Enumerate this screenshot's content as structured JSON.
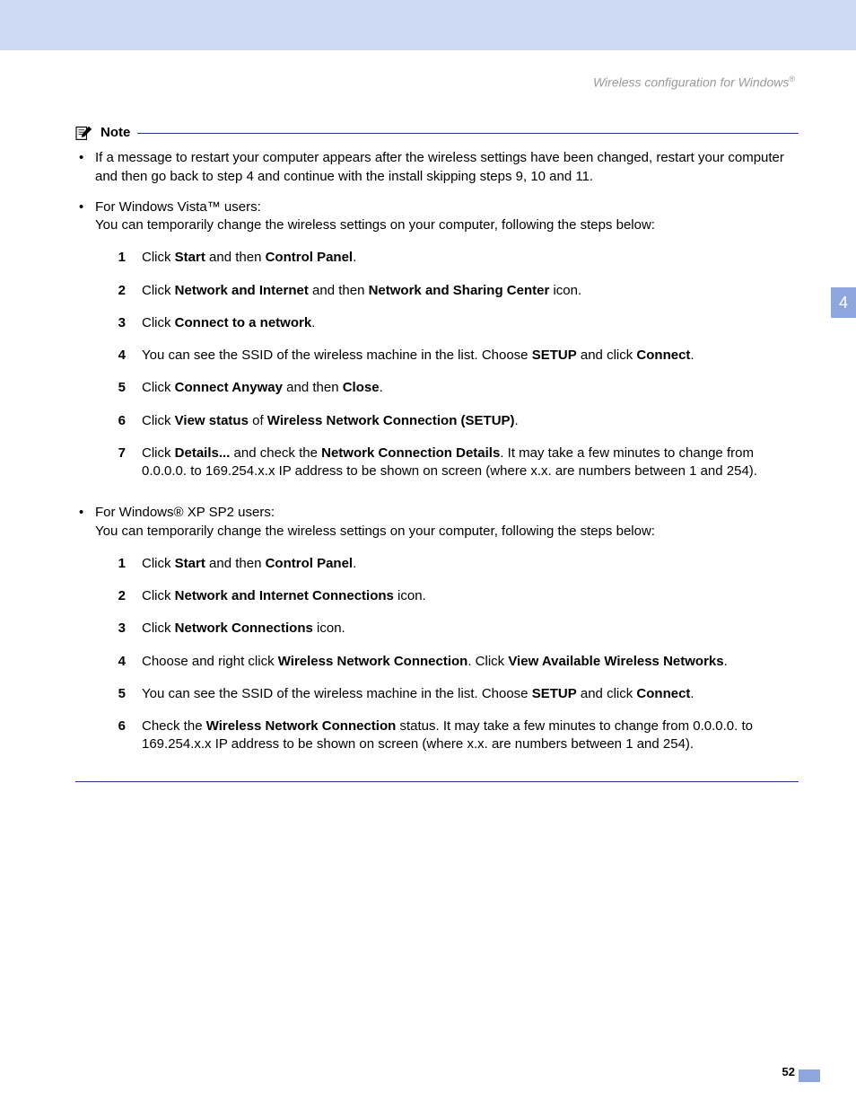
{
  "header": {
    "title": "Wireless configuration for Windows",
    "regmark": "®"
  },
  "sidetab": "4",
  "note": {
    "label": "Note"
  },
  "bullets": {
    "restart": {
      "text": "If a message to restart your computer appears after the wireless settings have been changed, restart your computer and then go back to step 4 and continue with the install skipping steps 9, 10 and 11."
    },
    "vista": {
      "intro1": "For Windows Vista™ users:",
      "intro2": "You can temporarily change the wireless settings on your computer, following the steps below:",
      "steps": {
        "s1": {
          "a": "Click ",
          "b": "Start",
          "c": " and then ",
          "d": "Control Panel",
          "e": "."
        },
        "s2": {
          "a": "Click ",
          "b": "Network and Internet",
          "c": " and then ",
          "d": "Network and Sharing Center",
          "e": " icon."
        },
        "s3": {
          "a": "Click ",
          "b": "Connect to a network",
          "c": "."
        },
        "s4": {
          "a": "You can see the SSID of the wireless machine in the list. Choose ",
          "b": "SETUP",
          "c": " and click ",
          "d": "Connect",
          "e": "."
        },
        "s5": {
          "a": "Click ",
          "b": "Connect Anyway",
          "c": " and then ",
          "d": "Close",
          "e": "."
        },
        "s6": {
          "a": "Click ",
          "b": "View status",
          "c": " of ",
          "d": "Wireless Network Connection (SETUP)",
          "e": "."
        },
        "s7": {
          "a": "Click ",
          "b": "Details...",
          "c": " and check the ",
          "d": "Network Connection Details",
          "e": ". It may take a few minutes to change from 0.0.0.0. to 169.254.x.x IP address to be shown on screen (where x.x. are numbers between 1 and 254)."
        }
      }
    },
    "xp": {
      "intro1": "For Windows® XP SP2 users:",
      "intro2": "You can temporarily change the wireless settings on your computer, following the steps below:",
      "steps": {
        "s1": {
          "a": "Click ",
          "b": "Start",
          "c": " and then ",
          "d": "Control Panel",
          "e": "."
        },
        "s2": {
          "a": "Click ",
          "b": "Network and Internet Connections",
          "c": " icon."
        },
        "s3": {
          "a": "Click ",
          "b": "Network Connections",
          "c": " icon."
        },
        "s4": {
          "a": "Choose and right click ",
          "b": "Wireless Network Connection",
          "c": ". Click ",
          "d": "View Available Wireless Networks",
          "e": "."
        },
        "s5": {
          "a": "You can see the SSID of the wireless machine in the list. Choose ",
          "b": "SETUP",
          "c": " and click ",
          "d": "Connect",
          "e": "."
        },
        "s6": {
          "a": "Check the ",
          "b": "Wireless Network Connection",
          "c": " status. It may take a few minutes to change from 0.0.0.0. to 169.254.x.x IP address to be shown on screen (where x.x. are numbers between 1 and 254)."
        }
      }
    }
  },
  "nums": {
    "n1": "1",
    "n2": "2",
    "n3": "3",
    "n4": "4",
    "n5": "5",
    "n6": "6",
    "n7": "7"
  },
  "pagenum": "52"
}
